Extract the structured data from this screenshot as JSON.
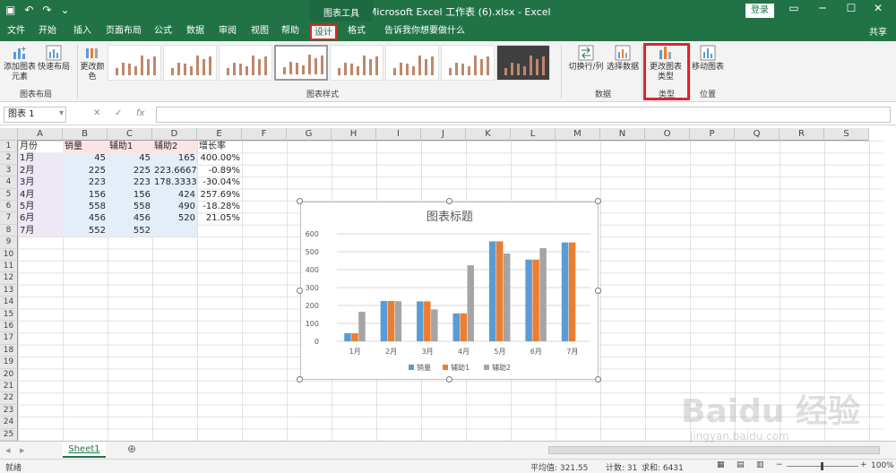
{
  "titlebar": {
    "title": "新建 Microsoft Excel 工作表 (6).xlsx  -  Excel",
    "context_group": "图表工具",
    "login": "登录",
    "save_icon": "save-icon",
    "undo_icon": "undo-icon",
    "redo_icon": "redo-icon"
  },
  "tabs": [
    "文件",
    "开始",
    "插入",
    "页面布局",
    "公式",
    "数据",
    "审阅",
    "视图",
    "帮助",
    "设计",
    "格式"
  ],
  "tell_me": "告诉我你想要做什么",
  "share": "共享",
  "ribbon": {
    "add_element": "添加图表元素",
    "quick_layout": "快速布局",
    "group_layout": "图表布局",
    "change_colors": "更改颜色",
    "group_styles": "图表样式",
    "switch_row_col": "切换行/列",
    "select_data": "选择数据",
    "group_data": "数据",
    "change_type": "更改图表类型",
    "group_type": "类型",
    "move_chart": "移动图表",
    "group_location": "位置"
  },
  "formula_bar": {
    "name_box": "图表 1",
    "fx": "fx",
    "cancel": "✕",
    "enter": "✓",
    "value": ""
  },
  "columns": [
    "A",
    "B",
    "C",
    "D",
    "E",
    "F",
    "G",
    "H",
    "I",
    "J",
    "K",
    "L",
    "M",
    "N",
    "O",
    "P",
    "Q",
    "R",
    "S"
  ],
  "rows": [
    "1",
    "2",
    "3",
    "4",
    "5",
    "6",
    "7",
    "8",
    "9",
    "10",
    "11",
    "12",
    "13",
    "14",
    "15",
    "16",
    "17",
    "18",
    "19",
    "20",
    "21",
    "22",
    "23",
    "24",
    "25"
  ],
  "sheet": {
    "headers": [
      "月份",
      "销量",
      "辅助1",
      "辅助2",
      "增长率"
    ],
    "data": [
      [
        "1月",
        "45",
        "45",
        "165",
        "400.00%"
      ],
      [
        "2月",
        "225",
        "225",
        "223.6667",
        "-0.89%"
      ],
      [
        "3月",
        "223",
        "223",
        "178.3333",
        "-30.04%"
      ],
      [
        "4月",
        "156",
        "156",
        "424",
        "257.69%"
      ],
      [
        "5月",
        "558",
        "558",
        "490",
        "-18.28%"
      ],
      [
        "6月",
        "456",
        "456",
        "520",
        "21.05%"
      ],
      [
        "7月",
        "552",
        "552",
        "",
        ""
      ]
    ]
  },
  "chart_data": {
    "type": "bar",
    "title": "图表标题",
    "categories": [
      "1月",
      "2月",
      "3月",
      "4月",
      "5月",
      "6月",
      "7月"
    ],
    "series": [
      {
        "name": "销量",
        "color": "#5b9bd5",
        "values": [
          45,
          225,
          223,
          156,
          558,
          456,
          552
        ]
      },
      {
        "name": "辅助1",
        "color": "#ed7d31",
        "values": [
          45,
          225,
          223,
          156,
          558,
          456,
          552
        ]
      },
      {
        "name": "辅助2",
        "color": "#a5a5a5",
        "values": [
          165,
          223.6667,
          178.3333,
          424,
          490,
          520,
          null
        ]
      }
    ],
    "yticks": [
      "0",
      "100",
      "200",
      "300",
      "400",
      "500",
      "600"
    ],
    "ylim": [
      0,
      600
    ],
    "legend": "bottom",
    "grid": true
  },
  "sheet_tab": "Sheet1",
  "status": {
    "ready": "就绪",
    "average": "平均值: 321.55",
    "count": "计数: 31",
    "sum": "求和: 6431",
    "zoom": "100%"
  },
  "watermark": "Baidu 经验",
  "watermark_sub": "jingyan.baidu.com"
}
